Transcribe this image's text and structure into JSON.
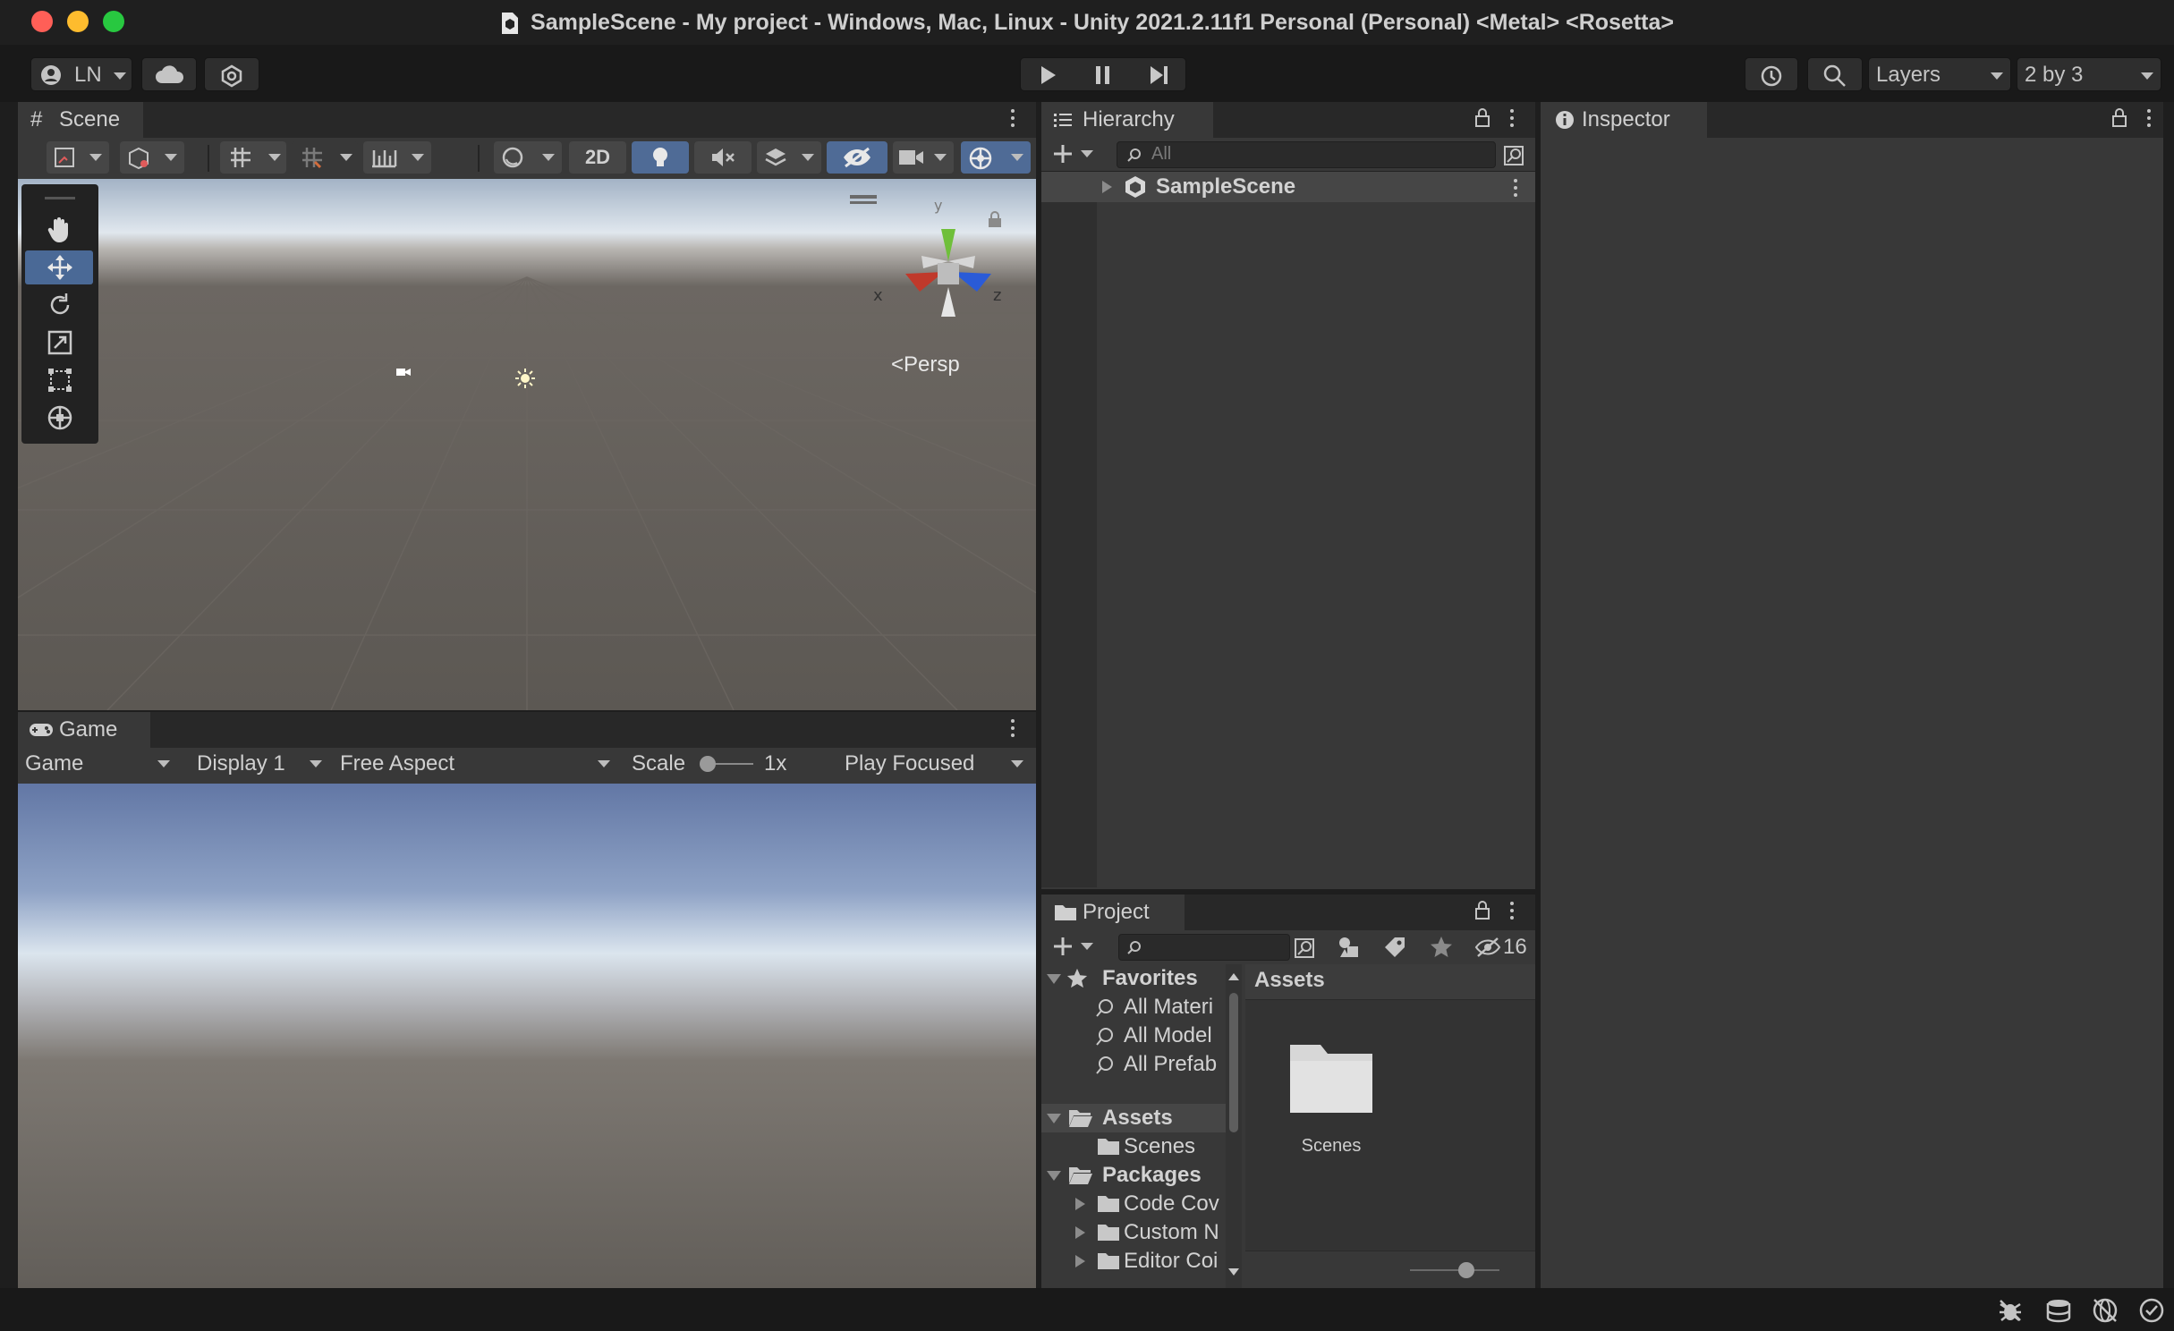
{
  "window": {
    "title": "SampleScene - My project - Windows, Mac, Linux - Unity 2021.2.11f1 Personal (Personal) <Metal> <Rosetta>"
  },
  "toolbar": {
    "account_label": "LN",
    "layers_label": "Layers",
    "layout_label": "2 by 3"
  },
  "scene": {
    "tab_label": "Scene",
    "toggle_2d_label": "2D",
    "projection_label": "Persp",
    "gizmo_axes": {
      "y": "y",
      "x": "x",
      "z": "z"
    }
  },
  "game": {
    "tab_label": "Game",
    "view_dropdown": "Game",
    "display_dropdown": "Display 1",
    "aspect_dropdown": "Free Aspect",
    "scale_label": "Scale",
    "scale_value": "1x",
    "play_mode_dropdown": "Play Focused"
  },
  "hierarchy": {
    "tab_label": "Hierarchy",
    "search_placeholder": "All",
    "root_item": "SampleScene"
  },
  "inspector": {
    "tab_label": "Inspector"
  },
  "project": {
    "tab_label": "Project",
    "hidden_count": "16",
    "tree": {
      "favorites_label": "Favorites",
      "favorites": [
        "All Materi",
        "All Model",
        "All Prefab"
      ],
      "assets_label": "Assets",
      "assets_children": [
        "Scenes"
      ],
      "packages_label": "Packages",
      "packages_children": [
        "Code Cov",
        "Custom N",
        "Editor Coi"
      ]
    },
    "breadcrumb": "Assets",
    "grid_items": [
      {
        "label": "Scenes",
        "icon": "folder-icon"
      }
    ]
  },
  "colors": {
    "traffic_red": "#ff5f57",
    "traffic_yellow": "#febc2e",
    "traffic_green": "#28c840",
    "selection_blue": "#4a6996",
    "axis_x": "#c0392b",
    "axis_y": "#6fbf3a",
    "axis_z": "#2a5bd7"
  }
}
